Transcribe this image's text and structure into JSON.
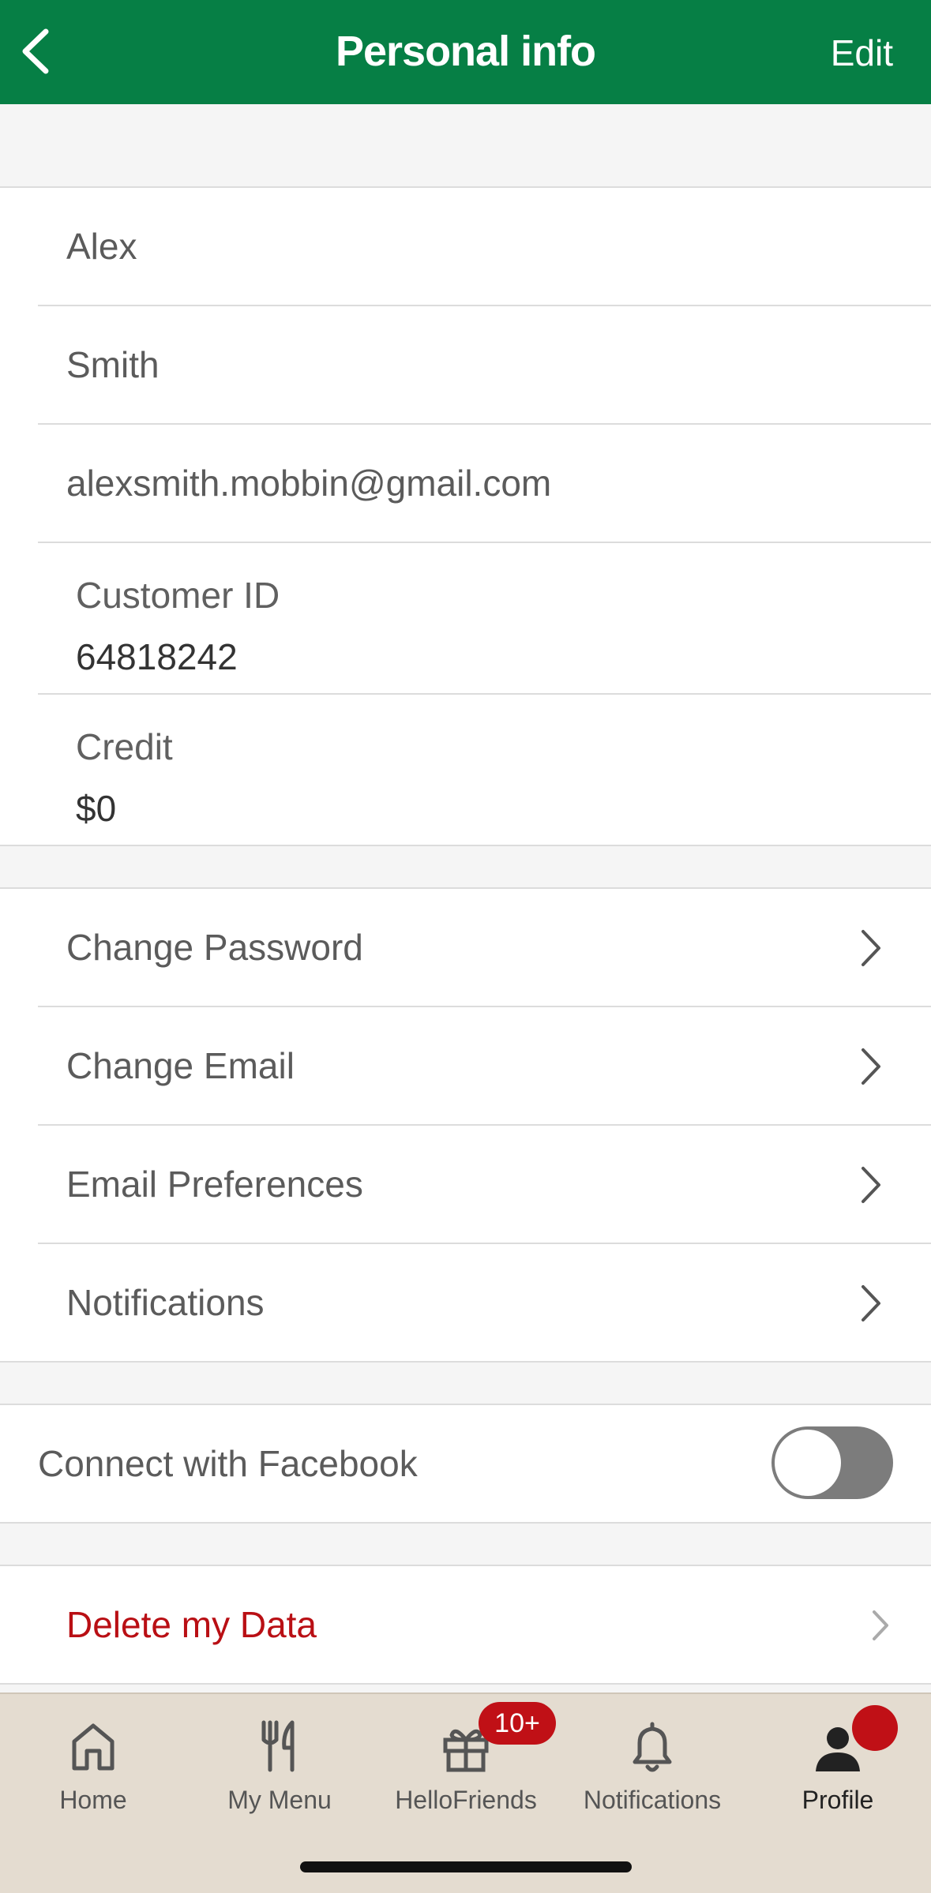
{
  "header": {
    "title": "Personal info",
    "edit_label": "Edit"
  },
  "profile": {
    "first_name": "Alex",
    "last_name": "Smith",
    "email": "alexsmith.mobbin@gmail.com",
    "customer_id_label": "Customer ID",
    "customer_id": "64818242",
    "credit_label": "Credit",
    "credit": "$0"
  },
  "settings": {
    "items": [
      {
        "label": "Change Password"
      },
      {
        "label": "Change Email"
      },
      {
        "label": "Email Preferences"
      },
      {
        "label": "Notifications"
      }
    ]
  },
  "facebook": {
    "label": "Connect with Facebook",
    "toggle_on": false
  },
  "delete": {
    "label": "Delete my Data",
    "color": "#b90f14"
  },
  "tabbar": {
    "tabs": [
      {
        "label": "Home",
        "icon": "home-icon"
      },
      {
        "label": "My Menu",
        "icon": "fork-knife-icon"
      },
      {
        "label": "HelloFriends",
        "icon": "gift-icon",
        "badge": "10+"
      },
      {
        "label": "Notifications",
        "icon": "bell-icon"
      },
      {
        "label": "Profile",
        "icon": "person-icon",
        "active": true
      }
    ]
  },
  "colors": {
    "brand_green": "#067f45",
    "badge_red": "#c01016",
    "tabbar_bg": "#e4dcd0"
  }
}
